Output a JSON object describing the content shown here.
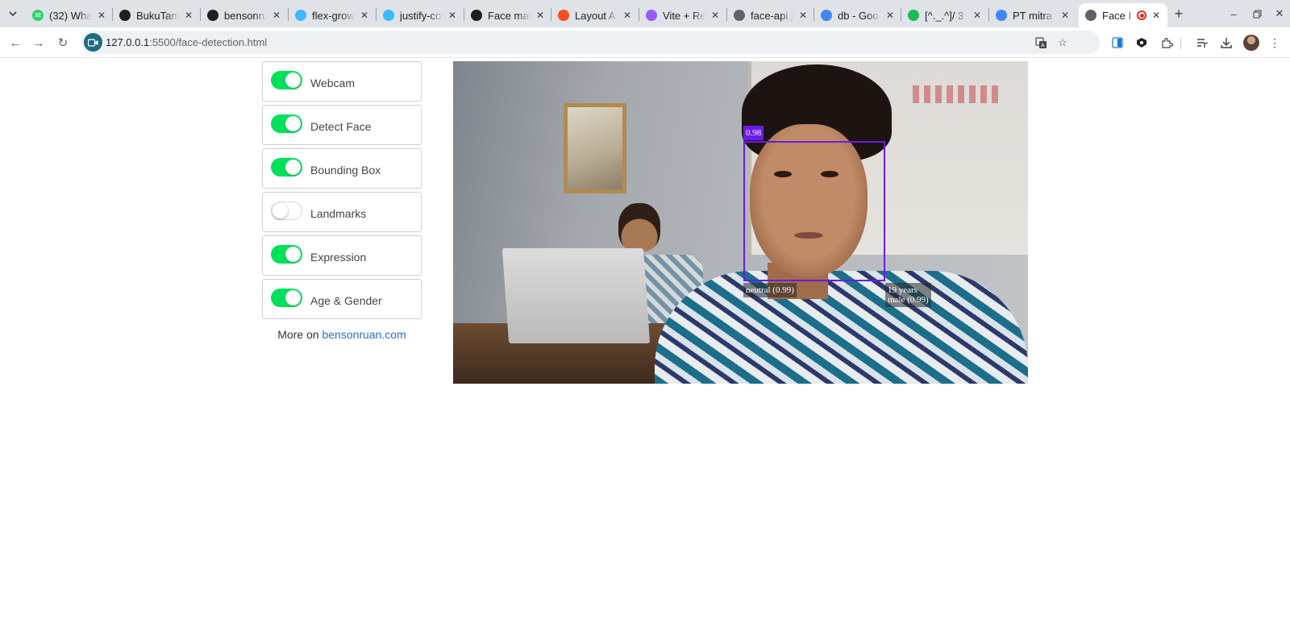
{
  "browser": {
    "tabs": [
      {
        "title": "(32) Wha",
        "icon": "whatsapp-icon",
        "color": "#25d366",
        "badge": "32",
        "active": false
      },
      {
        "title": "BukuTam",
        "icon": "github-icon",
        "color": "#1f1f1f",
        "active": false
      },
      {
        "title": "bensonru",
        "icon": "github-icon",
        "color": "#1f1f1f",
        "active": false
      },
      {
        "title": "flex-grow",
        "icon": "tailwind-icon",
        "color": "#38bdf8",
        "active": false
      },
      {
        "title": "justify-co",
        "icon": "tailwind-icon",
        "color": "#38bdf8",
        "active": false
      },
      {
        "title": "Face mat",
        "icon": "openai-icon",
        "color": "#1f1f1f",
        "active": false
      },
      {
        "title": "Layout A",
        "icon": "figma-icon",
        "color": "#f24e1e",
        "active": false
      },
      {
        "title": "Vite + Re",
        "icon": "vite-icon",
        "color": "#9b59f6",
        "active": false
      },
      {
        "title": "face-api.j",
        "icon": "globe-icon",
        "color": "#5f6368",
        "active": false
      },
      {
        "title": "db - Goo",
        "icon": "google-docs-icon",
        "color": "#4285f4",
        "active": false
      },
      {
        "title": "[^._.^]/ 3",
        "icon": "spotify-icon",
        "color": "#1db954",
        "active": false
      },
      {
        "title": "PT mitra",
        "icon": "google-icon",
        "color": "#4285f4",
        "active": false
      },
      {
        "title": "Face I",
        "icon": "globe-icon",
        "color": "#5f6368",
        "active": true,
        "recording": true
      }
    ],
    "url_host": "127.0.0.1",
    "url_path": ":5500/face-detection.html"
  },
  "controls": [
    {
      "label": "Webcam",
      "on": true
    },
    {
      "label": "Detect Face",
      "on": true
    },
    {
      "label": "Bounding Box",
      "on": true
    },
    {
      "label": "Landmarks",
      "on": false
    },
    {
      "label": "Expression",
      "on": true
    },
    {
      "label": "Age & Gender",
      "on": true
    }
  ],
  "more": {
    "prefix": "More on ",
    "link_text": "bensonruan.com"
  },
  "detection": {
    "score": "0.98",
    "expression": "neutral (0.99)",
    "age": "19 years",
    "gender": "male (0.99)",
    "box_color": "#6a1be8"
  }
}
